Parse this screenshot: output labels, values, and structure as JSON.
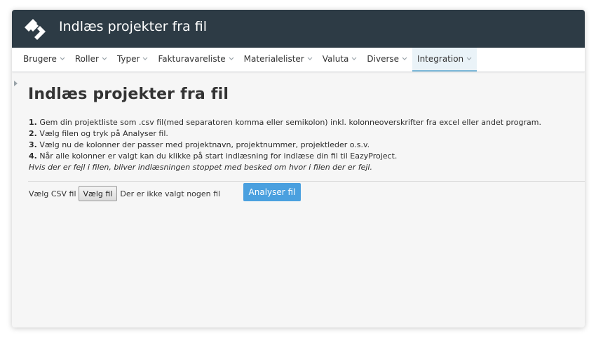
{
  "app": {
    "title": "Indlæs projekter fra fil",
    "logo_icon": "eazyproject-logo-icon",
    "colors": {
      "titlebar": "#2d3b45",
      "accent": "#4aa0df",
      "active_nav_underline": "#7cb8d9"
    }
  },
  "nav": {
    "items": [
      {
        "label": "Brugere",
        "icon": "chevron-down-icon",
        "active": false
      },
      {
        "label": "Roller",
        "icon": "chevron-down-icon",
        "active": false
      },
      {
        "label": "Typer",
        "icon": "chevron-down-icon",
        "active": false
      },
      {
        "label": "Fakturavareliste",
        "icon": "chevron-down-icon",
        "active": false
      },
      {
        "label": "Materialelister",
        "icon": "chevron-down-icon",
        "active": false
      },
      {
        "label": "Valuta",
        "icon": "chevron-down-icon",
        "active": false
      },
      {
        "label": "Diverse",
        "icon": "chevron-down-icon",
        "active": false
      },
      {
        "label": "Integration",
        "icon": "chevron-down-icon",
        "active": true
      }
    ]
  },
  "main": {
    "heading": "Indlæs projekter fra fil",
    "steps": [
      {
        "num": "1.",
        "text": " Gem din projektliste som .csv fil(med separatoren komma eller semikolon) inkl. kolonneoverskrifter fra excel eller andet program."
      },
      {
        "num": "2.",
        "text": " Vælg filen og tryk på Analyser fil."
      },
      {
        "num": "3.",
        "text": " Vælg nu de kolonner der passer med projektnavn, projektnummer, projektleder o.s.v."
      },
      {
        "num": "4.",
        "text": " Når alle kolonner er valgt kan du klikke på start indlæsning for indlæse din fil til EazyProject."
      }
    ],
    "note": "Hvis der er fejl i filen, bliver indlæsningen stoppet med besked om hvor i filen der er fejl.",
    "file": {
      "label": "Vælg CSV fil",
      "choose_button": "Vælg fil",
      "status": "Der er ikke valgt nogen fil"
    },
    "analyze_button": "Analyser fil"
  }
}
